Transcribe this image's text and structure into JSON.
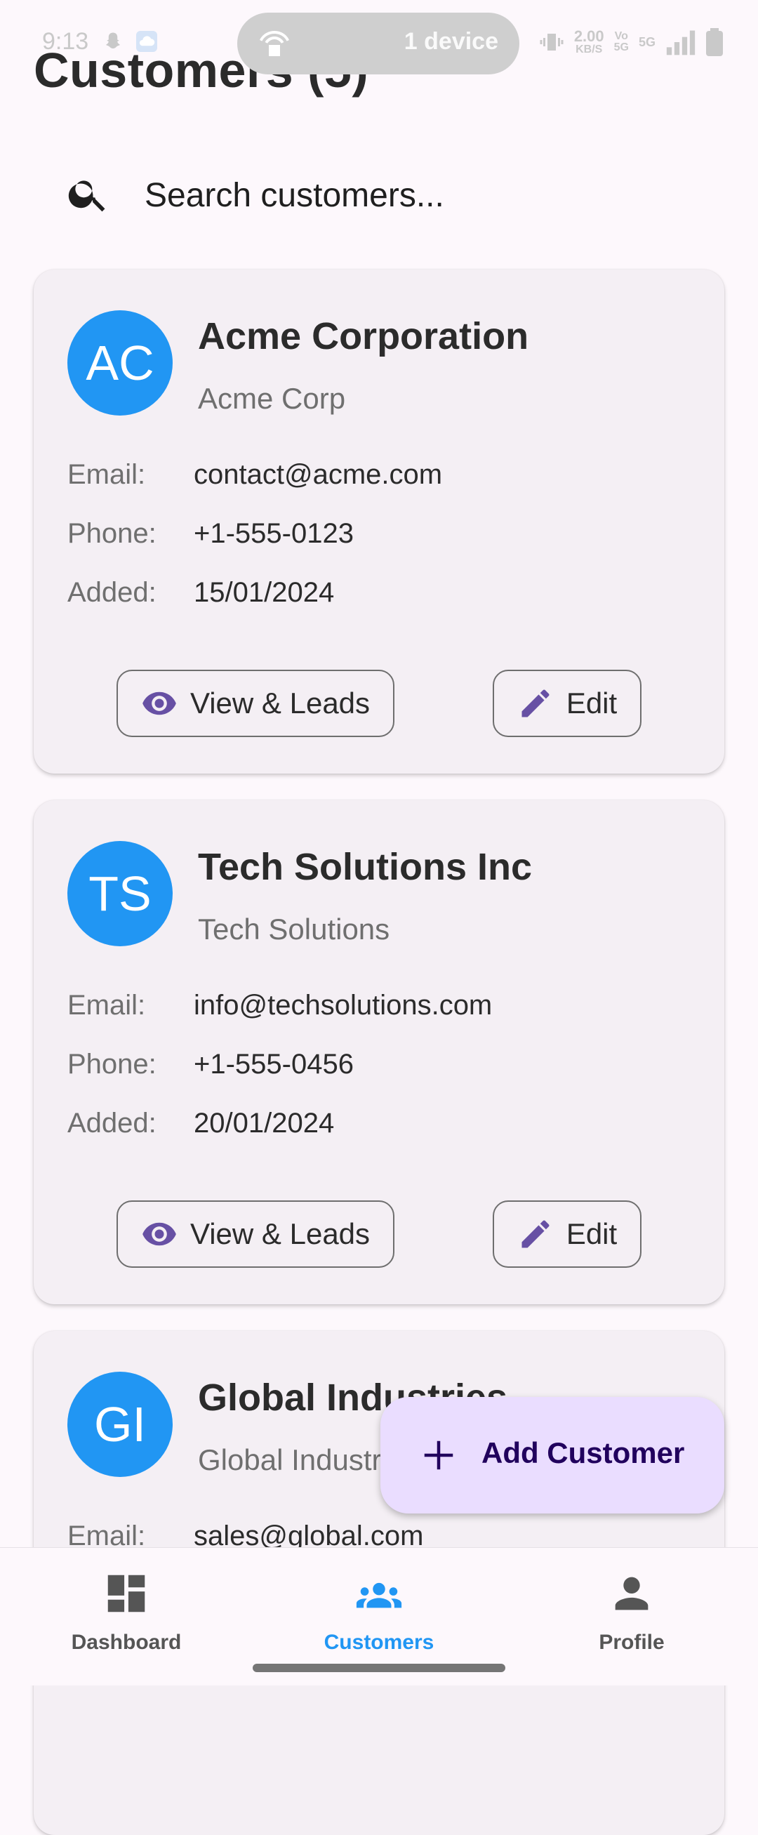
{
  "status_bar": {
    "time": "9:13",
    "pill_text": "1 device",
    "speed_value": "2.00",
    "speed_unit": "KB/S",
    "volte_top": "Vo",
    "volte_bottom": "5G",
    "signal_label": "5G"
  },
  "header": {
    "title": "Customers (5)"
  },
  "search": {
    "placeholder": "Search customers..."
  },
  "labels": {
    "email": "Email:",
    "phone": "Phone:",
    "added": "Added:",
    "view_button": "View & Leads",
    "edit_button": "Edit"
  },
  "customers": [
    {
      "initials": "AC",
      "name": "Acme Corporation",
      "company": "Acme Corp",
      "email": "contact@acme.com",
      "phone": "+1-555-0123",
      "added": "15/01/2024"
    },
    {
      "initials": "TS",
      "name": "Tech Solutions Inc",
      "company": "Tech Solutions",
      "email": "info@techsolutions.com",
      "phone": "+1-555-0456",
      "added": "20/01/2024"
    },
    {
      "initials": "GI",
      "name": "Global Industries",
      "company": "Global Industries",
      "email": "sales@global.com"
    }
  ],
  "fab": {
    "label": "Add Customer"
  },
  "nav": {
    "items": [
      {
        "label": "Dashboard",
        "icon": "dashboard-icon"
      },
      {
        "label": "Customers",
        "icon": "people-icon"
      },
      {
        "label": "Profile",
        "icon": "person-icon"
      }
    ],
    "active_index": 1
  },
  "colors": {
    "accent": "#2196f3",
    "avatar": "#2196f3",
    "fab_bg": "#eaddff",
    "icon_purple": "#6750a4",
    "nav_inactive": "#555555"
  }
}
